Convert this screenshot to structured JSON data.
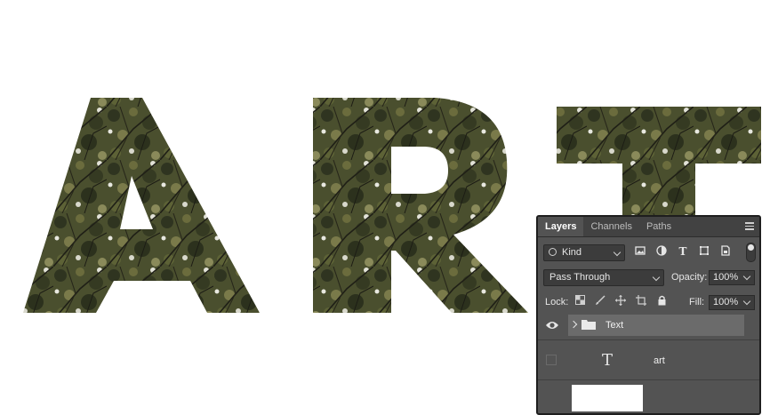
{
  "artwork": {
    "letters": [
      "A",
      "R",
      "T"
    ]
  },
  "panel": {
    "tabs": [
      {
        "label": "Layers",
        "active": true
      },
      {
        "label": "Channels",
        "active": false
      },
      {
        "label": "Paths",
        "active": false
      }
    ],
    "filter": {
      "label": "Kind",
      "icons": [
        "image-filter-icon",
        "adjustment-filter-icon",
        "type-filter-icon",
        "shape-filter-icon",
        "smart-object-filter-icon",
        "filter-toggle-icon"
      ]
    },
    "blend": {
      "mode": "Pass Through",
      "opacity_label": "Opacity:",
      "opacity_value": "100%"
    },
    "lock": {
      "label": "Lock:",
      "fill_label": "Fill:",
      "fill_value": "100%",
      "icons": [
        "lock-transparent-icon",
        "lock-paint-icon",
        "lock-position-icon",
        "lock-artboard-icon",
        "lock-all-icon"
      ]
    },
    "layers": [
      {
        "name": "Text",
        "type": "group",
        "visible": true,
        "selected": true
      },
      {
        "name": "art",
        "type": "text",
        "visible": false,
        "selected": false
      }
    ]
  },
  "colors": {
    "panel_bg": "#535353",
    "tab_bar_bg": "#424242",
    "selected_layer": "#6b6b6b",
    "foliage_dark": "#3a3f26",
    "foliage_mid": "#5a5f35"
  }
}
